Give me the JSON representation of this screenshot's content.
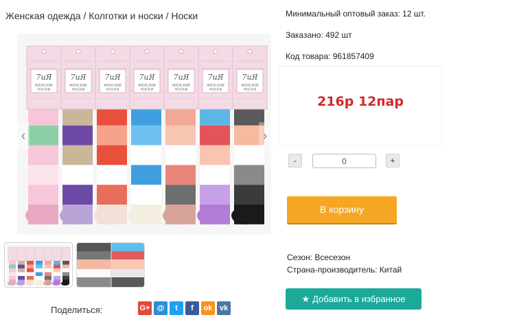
{
  "breadcrumb": {
    "items": [
      "Женская одежда",
      "Колготки и носки",
      "Носки"
    ],
    "separator": " / "
  },
  "product": {
    "min_order": "Минимальный оптовый заказ: 12 шт.",
    "ordered": "Заказано: 492 шт",
    "code": "Код товара: 961857409",
    "price": "216р 12пар",
    "quantity": "0",
    "minus_label": "-",
    "plus_label": "+",
    "cart_label": "В корзину",
    "season": "Сезон: Всесезон",
    "country": "Страна-производитель: Китай",
    "favorite_label": "Добавить в избранное"
  },
  "photo": {
    "tag_logo": "7иЯ",
    "tag_text_1": "ЖЕНСКИЕ",
    "tag_text_2": "НОСКИ",
    "arrow_left": "‹",
    "arrow_right": "›"
  },
  "share": {
    "label": "Поделиться:",
    "icons": [
      {
        "name": "google-plus-icon",
        "glyph": "G+",
        "color": "#dd4b39"
      },
      {
        "name": "email-icon",
        "glyph": "@",
        "color": "#2a8fd6"
      },
      {
        "name": "twitter-icon",
        "glyph": "t",
        "color": "#1da1f2"
      },
      {
        "name": "facebook-icon",
        "glyph": "f",
        "color": "#3b5998"
      },
      {
        "name": "odnoklassniki-icon",
        "glyph": "ok",
        "color": "#f7931e"
      },
      {
        "name": "vk-icon",
        "glyph": "vk",
        "color": "#4c75a3"
      }
    ]
  },
  "colors": {
    "price": "#d02a2a",
    "cart_button": "#f5a623",
    "favorite_button": "#1ba99a"
  }
}
